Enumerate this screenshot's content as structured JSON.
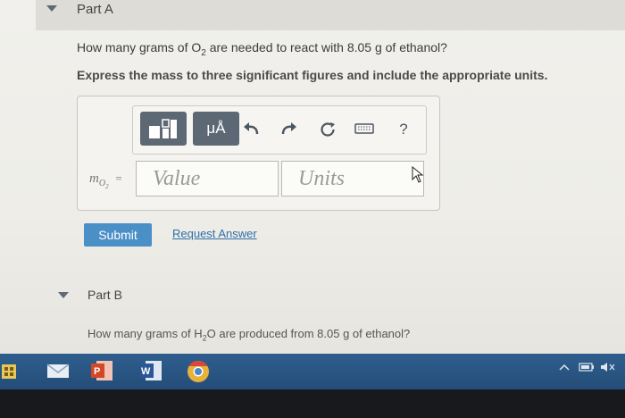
{
  "partA": {
    "title": "Part A",
    "question_pre": "How many grams of O",
    "question_sub": "2",
    "question_post": " are needed to react with 8.05 g of ethanol?",
    "instruction": "Express the mass to three significant figures and include the appropriate units.",
    "toolbar": {
      "template_icon": "template-icon",
      "units_label": "μÅ",
      "undo_icon": "undo-icon",
      "redo_icon": "redo-icon",
      "reset_icon": "reset-icon",
      "keyboard_icon": "keyboard-icon",
      "help_label": "?"
    },
    "variable": {
      "symbol": "m",
      "sub": "O",
      "subsub": "2",
      "equals": "="
    },
    "value_placeholder": "Value",
    "units_placeholder": "Units",
    "submit_label": "Submit",
    "request_answer_label": "Request Answer"
  },
  "partB": {
    "title": "Part B",
    "question_pre": "How many grams of H",
    "question_sub": "2",
    "question_post": "O are produced from 8.05 g of ethanol?"
  },
  "taskbar": {
    "apps": [
      "start-icon",
      "mail-icon",
      "powerpoint-icon",
      "word-icon",
      "chrome-icon"
    ],
    "tray_icons": [
      "chevron-up-icon",
      "battery-icon",
      "speaker-icon"
    ]
  },
  "colors": {
    "accent": "#4b8fc7",
    "toolbar_button": "#5d6875",
    "taskbar": "#2f5e8e"
  }
}
